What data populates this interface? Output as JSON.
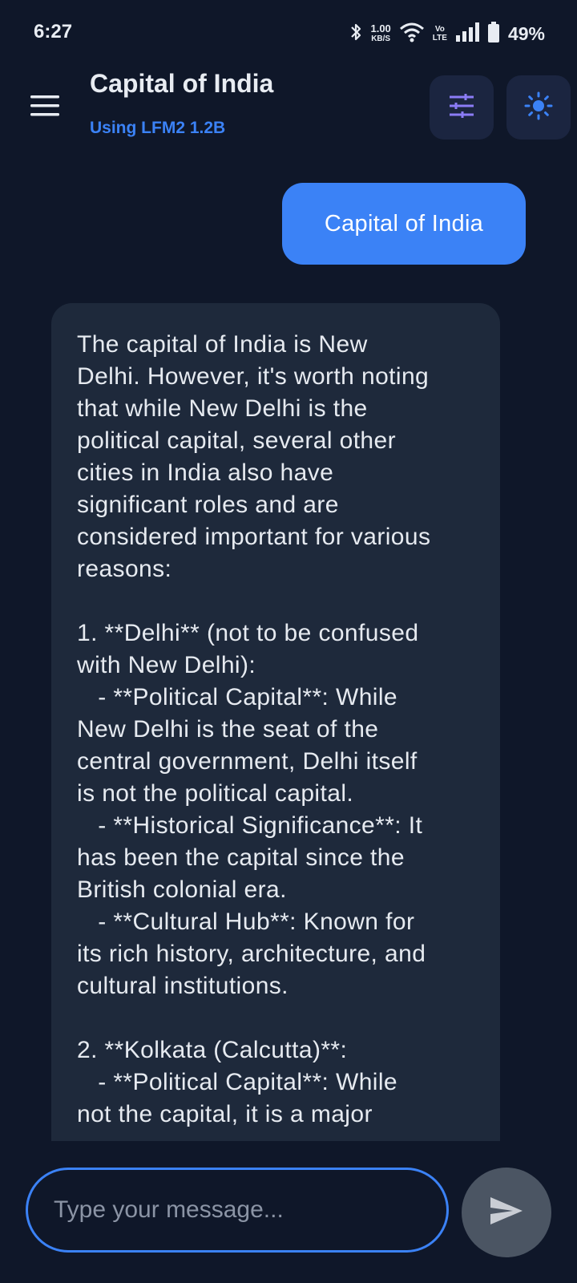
{
  "status_bar": {
    "time": "6:27",
    "net_speed_value": "1.00",
    "net_speed_unit": "KB/S",
    "volte_top": "Vo",
    "volte_bottom": "LTE",
    "battery_percent": "49%"
  },
  "header": {
    "title": "Capital of India",
    "subtitle": "Using LFM2 1.2B",
    "menu_icon": "hamburger-menu-icon",
    "settings_icon": "sliders-icon",
    "theme_icon": "sun-icon"
  },
  "chat": {
    "user_message": "Capital of India",
    "assistant_message": "The capital of India is New\nDelhi. However, it's worth noting\nthat while New Delhi is the\npolitical capital, several other\ncities in India also have\nsignificant roles and are\nconsidered important for various\nreasons:\n\n1. **Delhi** (not to be confused\nwith New Delhi):\n   - **Political Capital**: While\nNew Delhi is the seat of the\ncentral government, Delhi itself\nis not the political capital.\n   - **Historical Significance**: It\nhas been the capital since the\nBritish colonial era.\n   - **Cultural Hub**: Known for\nits rich history, architecture, and\ncultural institutions.\n\n2. **Kolkata (Calcutta)**:\n   - **Political Capital**: While\nnot the capital, it is a major"
  },
  "composer": {
    "placeholder": "Type your message...",
    "value": "",
    "send_icon": "send-icon"
  },
  "colors": {
    "background": "#0f1729",
    "accent": "#3b82f6",
    "assistant_bubble": "#1e293b",
    "header_button": "#1b2540",
    "send_button": "#4b5563"
  }
}
